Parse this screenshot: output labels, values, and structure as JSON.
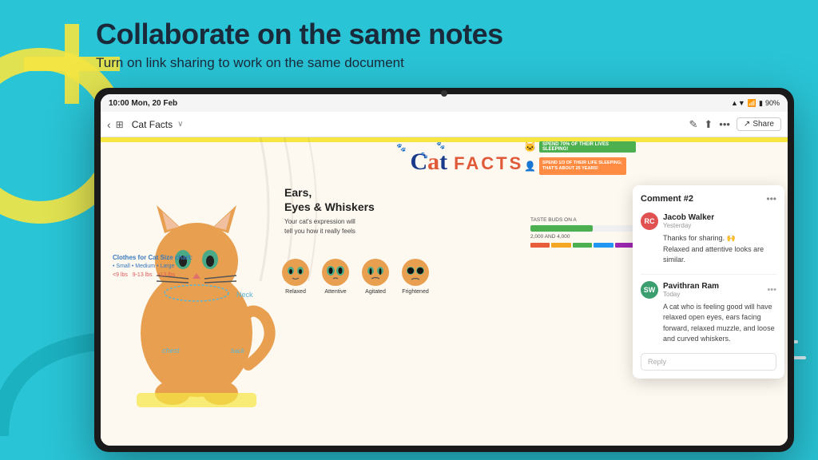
{
  "page": {
    "background_color": "#29c4d6",
    "main_heading": "Collaborate on the same notes",
    "sub_heading": "Turn on link sharing to work on the same document"
  },
  "status_bar": {
    "time": "10:00  Mon, 20 Feb",
    "battery": "90%",
    "signal": "▲▼"
  },
  "toolbar": {
    "title": "Cat Facts",
    "chevron": "~",
    "share_label": "Share"
  },
  "note": {
    "cat_word": "Cat",
    "facts_word": "FACTS",
    "size_chart": {
      "label": "Clothes for Cat Size chart:",
      "sizes": "• Small • Medium • Large",
      "small": "<9 lbs",
      "medium": "9-13 lbs",
      "large": ">13 lbs"
    },
    "neck_label": "Neck",
    "chest_label": "chest",
    "back_label": "back",
    "ears_title": "Ears,\nEyes & Whiskers",
    "ears_desc": "Your cat's expression will\ntell you how it really feels",
    "expressions": [
      "Relaxed",
      "Attentive",
      "Agitated",
      "Frightened"
    ]
  },
  "infographic": {
    "bar1": {
      "percent": "70%",
      "label": "SPEND 70% OF THEIR LIVES SLEEPING!",
      "color": "#4caf50",
      "width": "70%"
    },
    "bar2": {
      "percent": "1/3",
      "label": "SPEND 1/3 OF THEIR LIFE SLEEPING;\nTHAT'S ABOUT 25 YEARS!",
      "color": "#ff8c42",
      "width": "50%"
    }
  },
  "comment_panel": {
    "title": "Comment #2",
    "menu_icon": "•••",
    "comments": [
      {
        "avatar_initials": "RC",
        "avatar_color": "#e05252",
        "username": "Jacob Walker",
        "time": "Yesterday",
        "text": "Thanks for sharing. 🙌\nRelaxed and attentive looks are similar.",
        "menu_icon": ""
      },
      {
        "avatar_initials": "SW",
        "avatar_color": "#3a9e6e",
        "username": "Pavithran Ram",
        "time": "Today",
        "text": "A cat who is feeling good will have relaxed\nopen eyes, ears facing forward, relaxed\nmuzzle, and loose and curved whiskers.",
        "menu_icon": "•••"
      }
    ],
    "reply_placeholder": "Reply"
  },
  "icons": {
    "back": "‹",
    "grid": "⊞",
    "pencil": "✎",
    "export": "⬆",
    "more": "•••",
    "share_icon": "↗"
  },
  "decorative": {
    "paw_prints": [
      "🐾",
      "🐾",
      "🐾",
      "🐾"
    ],
    "white_lines": [
      80,
      60,
      90,
      50,
      70
    ]
  }
}
